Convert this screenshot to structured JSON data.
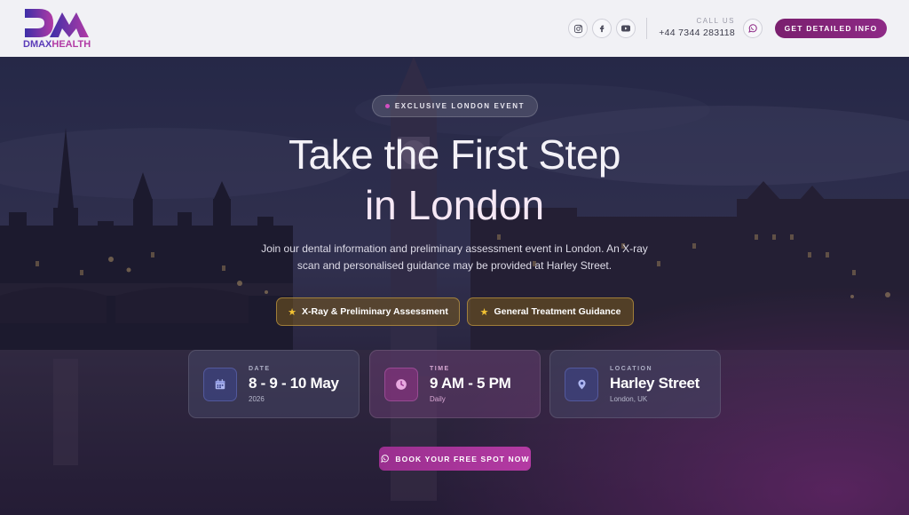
{
  "brand": {
    "logo_text_dmax": "DMAX",
    "logo_text_health": "HEALTH",
    "primary_color": "#7a1f6e",
    "accent_color": "#b43aa3"
  },
  "header": {
    "social": [
      {
        "name": "instagram-icon"
      },
      {
        "name": "facebook-icon"
      },
      {
        "name": "youtube-icon"
      }
    ],
    "call_label": "CALL US",
    "phone": "+44 7344 283118",
    "whatsapp_icon": "whatsapp-icon",
    "cta_label": "GET DETAILED INFO"
  },
  "hero": {
    "badge": "EXCLUSIVE LONDON EVENT",
    "title_line1": "Take the First Step",
    "title_line2": "in London",
    "subtext": "Join our dental information and preliminary assessment event in London. An X-ray scan and personalised guidance may be provided at Harley Street.",
    "features": [
      {
        "label": "X-Ray & Preliminary Assessment",
        "icon": "star-icon"
      },
      {
        "label": "General Treatment Guidance",
        "icon": "star-icon"
      }
    ],
    "cards": [
      {
        "label": "DATE",
        "value": "8 - 9 - 10 May",
        "sub": "2026",
        "icon": "calendar-icon"
      },
      {
        "label": "TIME",
        "value": "9 AM - 5 PM",
        "sub": "Daily",
        "icon": "clock-icon"
      },
      {
        "label": "LOCATION",
        "value": "Harley Street",
        "sub": "London, UK",
        "icon": "location-pin-icon"
      }
    ],
    "book_label": "BOOK YOUR FREE SPOT NOW"
  }
}
